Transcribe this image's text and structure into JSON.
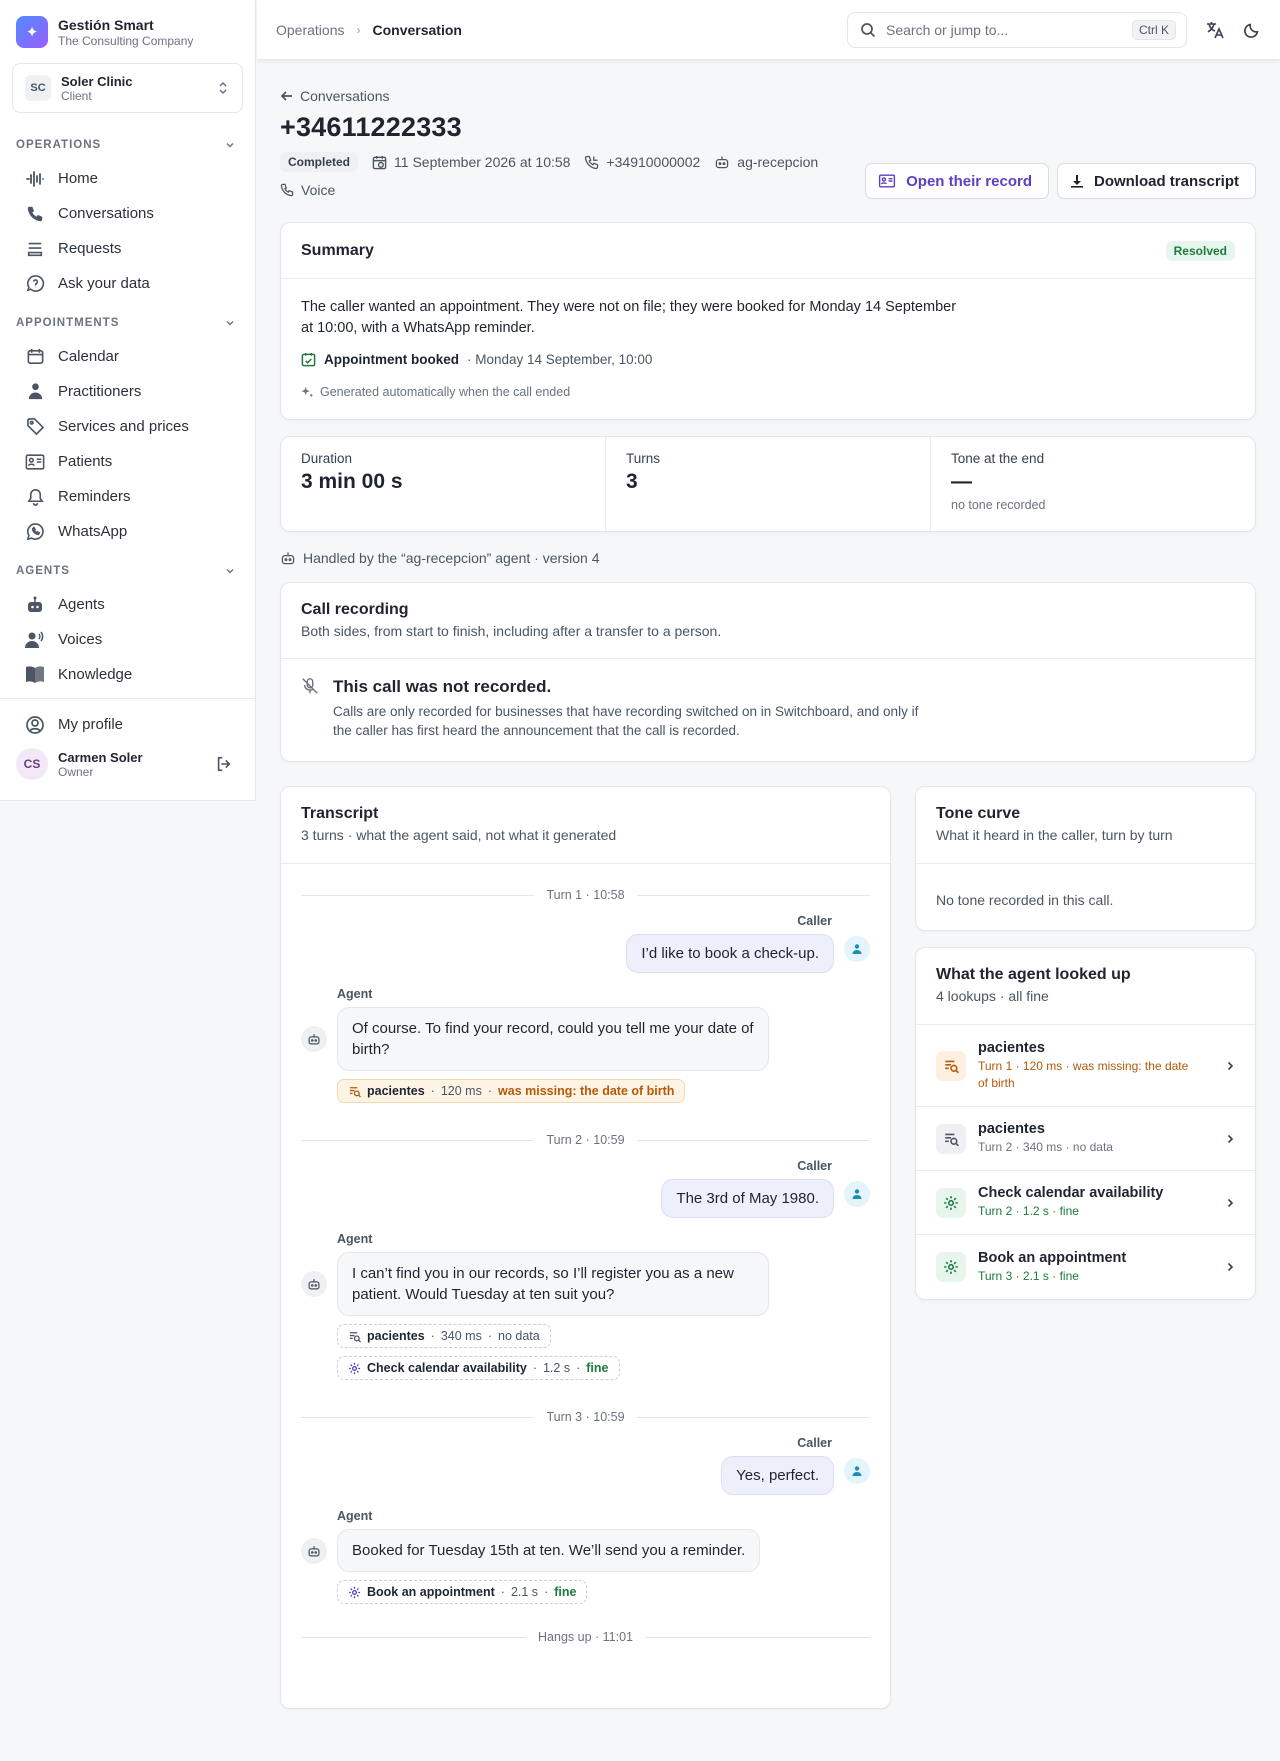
{
  "brand": {
    "name": "Gestión Smart",
    "subtitle": "The Consulting Company"
  },
  "org": {
    "initials": "SC",
    "name": "Soler Clinic",
    "role": "Client"
  },
  "nav": {
    "operations_label": "OPERATIONS",
    "operations": [
      "Home",
      "Conversations",
      "Requests",
      "Ask your data"
    ],
    "appointments_label": "APPOINTMENTS",
    "appointments": [
      "Calendar",
      "Practitioners",
      "Services and prices",
      "Patients",
      "Reminders",
      "WhatsApp"
    ],
    "agents_label": "AGENTS",
    "agents": [
      "Agents",
      "Voices",
      "Knowledge"
    ],
    "profile": "My profile"
  },
  "user": {
    "initials": "CS",
    "name": "Carmen Soler",
    "role": "Owner"
  },
  "topbar": {
    "breadcrumb_parent": "Operations",
    "breadcrumb_current": "Conversation",
    "search_placeholder": "Search or jump to...",
    "shortcut": "Ctrl K"
  },
  "conversation": {
    "back_label": "Conversations",
    "title": "+34611222333",
    "status": "Completed",
    "datetime": "11 September 2026 at 10:58",
    "number": "+34910000002",
    "agent": "ag-recepcion",
    "channel": "Voice",
    "open_record": "Open their record",
    "download_transcript": "Download transcript"
  },
  "summary": {
    "title": "Summary",
    "badge": "Resolved",
    "text": "The caller wanted an appointment. They were not on file; they were booked for Monday 14 September at 10:00, with a WhatsApp reminder.",
    "appointment_label": "Appointment booked",
    "appointment_value": "· Monday 14 September, 10:00",
    "generated": "Generated automatically when the call ended"
  },
  "stats": {
    "duration_label": "Duration",
    "duration_value": "3 min 00 s",
    "turns_label": "Turns",
    "turns_value": "3",
    "tone_label": "Tone at the end",
    "tone_value": "—",
    "tone_note": "no tone recorded"
  },
  "handled_by": "Handled by the “ag-recepcion” agent · version 4",
  "recording": {
    "title": "Call recording",
    "subtitle": "Both sides, from start to finish, including after a transfer to a person.",
    "empty_title": "This call was not recorded.",
    "empty_text": "Calls are only recorded for businesses that have recording switched on in Switchboard, and only if the caller has first heard the announcement that the call is recorded."
  },
  "transcript": {
    "title": "Transcript",
    "subtitle": "3 turns · what the agent said, not what it generated",
    "caller_label": "Caller",
    "agent_label": "Agent",
    "turns": [
      {
        "divider": "Turn 1 · 10:58",
        "caller": "I’d like to book a check-up.",
        "agent": "Of course. To find your record, could you tell me your date of birth?",
        "tools": [
          {
            "name": "pacientes",
            "time": "120 ms",
            "status": "was missing: the date of birth"
          }
        ]
      },
      {
        "divider": "Turn 2 · 10:59",
        "caller": "The 3rd of May 1980.",
        "agent": "I can’t find you in our records, so I’ll register you as a new patient. Would Tuesday at ten suit you?",
        "tools": [
          {
            "name": "pacientes",
            "time": "340 ms",
            "status": "no data"
          },
          {
            "name": "Check calendar availability",
            "time": "1.2 s",
            "status": "fine"
          }
        ]
      },
      {
        "divider": "Turn 3 · 10:59",
        "caller": "Yes, perfect.",
        "agent": "Booked for Tuesday 15th at ten. We’ll send you a reminder.",
        "tools": [
          {
            "name": "Book an appointment",
            "time": "2.1 s",
            "status": "fine"
          }
        ]
      }
    ],
    "end": "Hangs up · 11:01"
  },
  "tone_curve": {
    "title": "Tone curve",
    "subtitle": "What it heard in the caller, turn by turn",
    "empty": "No tone recorded in this call."
  },
  "lookups": {
    "title": "What the agent looked up",
    "subtitle": "4 lookups · all fine",
    "items": [
      {
        "name": "pacientes",
        "detail": "Turn 1 · 120 ms · was missing: the date of birth"
      },
      {
        "name": "pacientes",
        "detail": "Turn 2 · 340 ms · no data"
      },
      {
        "name": "Check calendar availability",
        "detail": "Turn 2 · 1.2 s · fine"
      },
      {
        "name": "Book an appointment",
        "detail": "Turn 3 · 2.1 s · fine"
      }
    ]
  },
  "colors": {
    "accent": "#5b3fc4",
    "success": "#1e7a3c",
    "warning": "#b45a09"
  }
}
